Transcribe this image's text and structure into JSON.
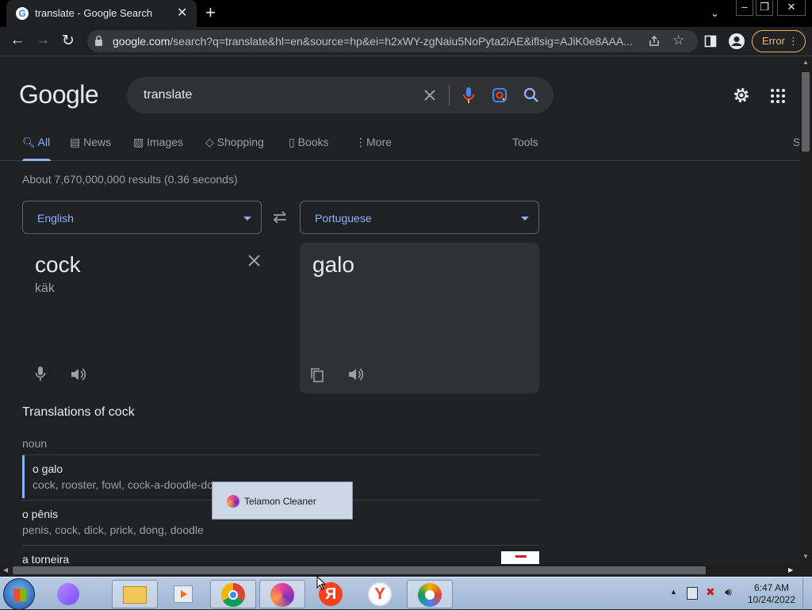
{
  "browser": {
    "tab_title": "translate - Google Search",
    "favicon_letter": "G",
    "url_host": "google.com",
    "url_path": "/search?q=translate&hl=en&source=hp&ei=h2xWY-zgNaiu5NoPyta2iAE&iflsig=AJiK0e8AAA...",
    "error_label": "Error"
  },
  "google": {
    "logo": "Google",
    "query": "translate",
    "tabs": [
      "All",
      "News",
      "Images",
      "Shopping",
      "Books",
      "More"
    ],
    "tools_label": "Tools",
    "partial_right_label": "S",
    "result_stats": "About 7,670,000,000 results (0.36 seconds)"
  },
  "translator": {
    "source_lang": "English",
    "target_lang": "Portuguese",
    "source_text": "cock",
    "source_phonetic": "käk",
    "output_text": "galo",
    "heading": "Translations of cock",
    "part_of_speech": "noun",
    "entries": [
      {
        "word": "o galo",
        "synonyms": "cock, rooster, fowl, cock-a-doodle-doo"
      },
      {
        "word": "o pênis",
        "synonyms": "penis, cock, dick, prick, dong, doodle"
      },
      {
        "word": "a torneira",
        "synonyms": ""
      }
    ]
  },
  "tooltip": {
    "label": "Telamon Cleaner"
  },
  "taskbar": {
    "time": "6:47 AM",
    "date": "10/24/2022",
    "apps": [
      "start-orb",
      "alice",
      "file-explorer",
      "media-player",
      "chrome",
      "telamon-cleaner",
      "yandex-browser",
      "yandex",
      "vpn"
    ]
  },
  "colors": {
    "accent": "#8ab4f8",
    "page_bg": "#202124",
    "error": "#f2b84b"
  }
}
